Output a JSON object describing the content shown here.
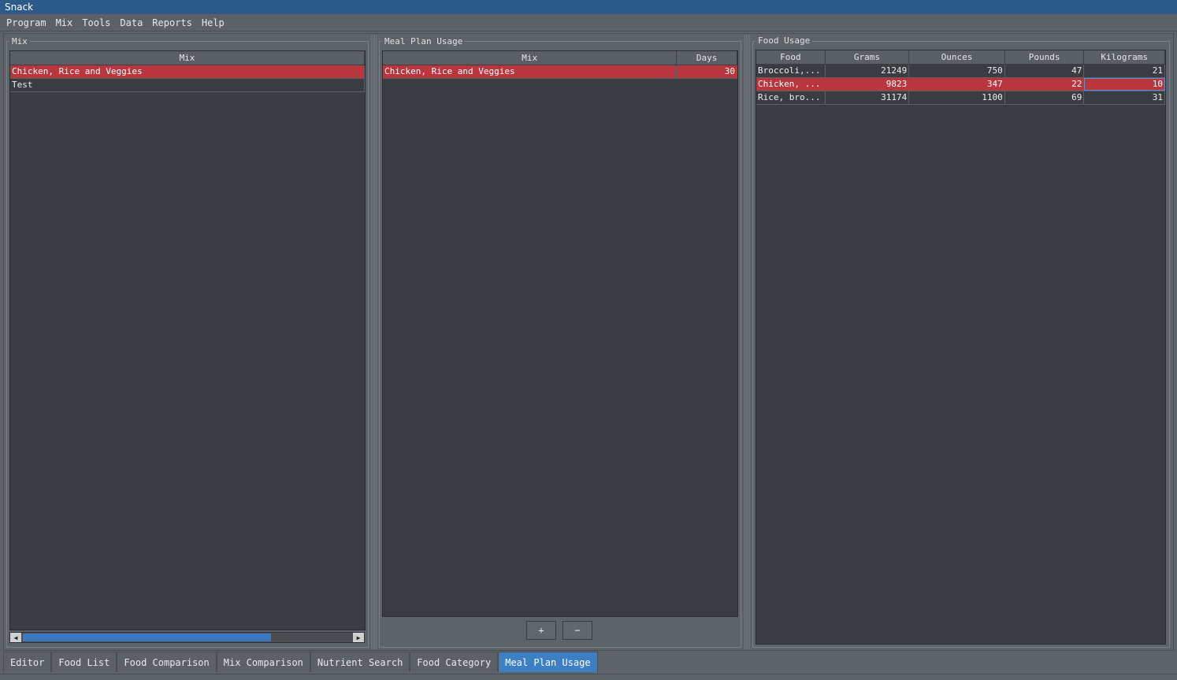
{
  "window": {
    "title": "Snack"
  },
  "menu": [
    "Program",
    "Mix",
    "Tools",
    "Data",
    "Reports",
    "Help"
  ],
  "mix_panel": {
    "title": "Mix",
    "column": "Mix",
    "rows": [
      "Chicken, Rice and Veggies",
      "Test"
    ]
  },
  "meal_panel": {
    "title": "Meal Plan Usage",
    "columns": [
      "Mix",
      "Days"
    ],
    "rows": [
      {
        "mix": "Chicken, Rice and Veggies",
        "days": "30"
      }
    ],
    "add_label": "+",
    "remove_label": "−"
  },
  "food_panel": {
    "title": "Food Usage",
    "columns": [
      "Food",
      "Grams",
      "Ounces",
      "Pounds",
      "Kilograms"
    ],
    "rows": [
      {
        "food": "Broccoli,...",
        "grams": "21249",
        "ounces": "750",
        "pounds": "47",
        "kilograms": "21"
      },
      {
        "food": "Chicken, ...",
        "grams": "9823",
        "ounces": "347",
        "pounds": "22",
        "kilograms": "10"
      },
      {
        "food": "Rice, bro...",
        "grams": "31174",
        "ounces": "1100",
        "pounds": "69",
        "kilograms": "31"
      }
    ]
  },
  "tabs": [
    "Editor",
    "Food List",
    "Food Comparison",
    "Mix Comparison",
    "Nutrient Search",
    "Food Category",
    "Meal Plan Usage"
  ],
  "active_tab": "Meal Plan Usage",
  "colors": {
    "selection": "#b9363f",
    "accent": "#3c7fc4",
    "background": "#393d42"
  }
}
